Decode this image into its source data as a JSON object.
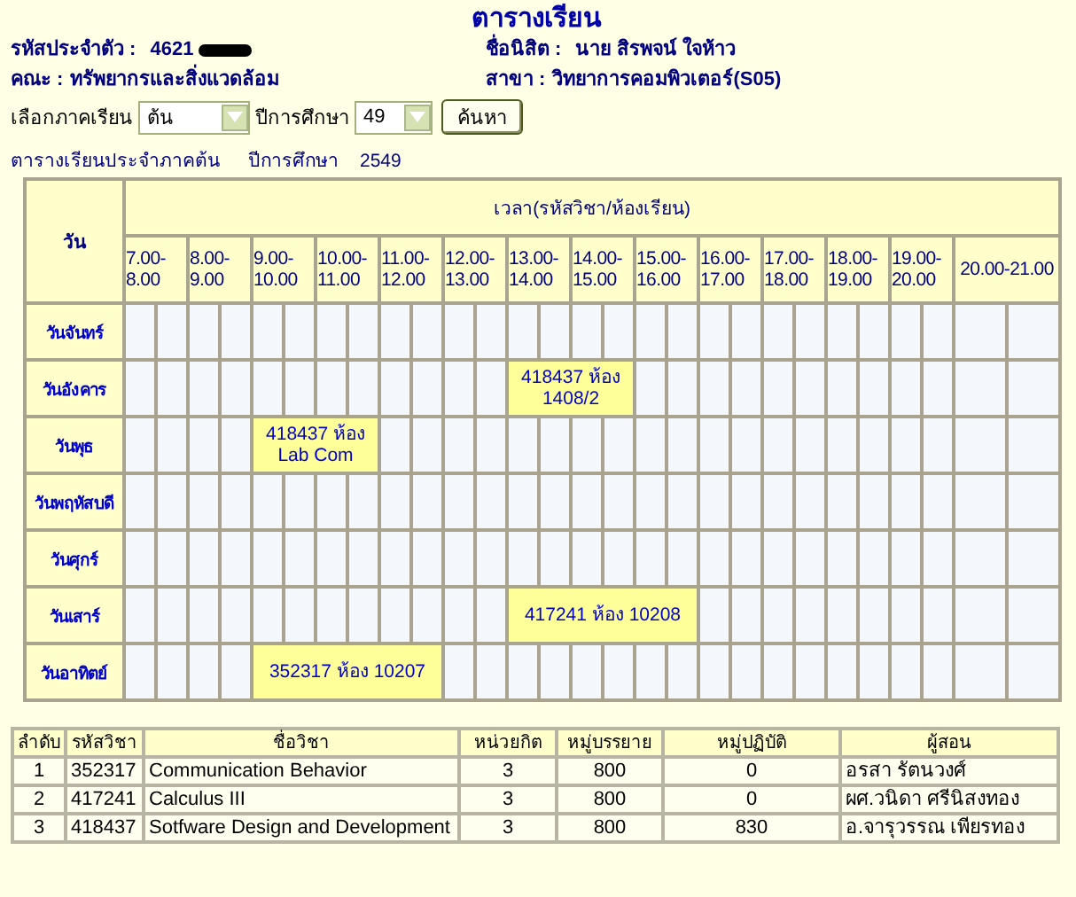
{
  "title": "ตารางเรียน",
  "student": {
    "id_label": "รหัสประจำตัว :",
    "id_value": "4621",
    "name_label": "ชื่อนิสิต :",
    "name_value": "นาย สิรพจน์ ใจห้าว",
    "faculty_label": "คณะ :",
    "faculty_value": "ทรัพยากรและสิ่งแวดล้อม",
    "major_label": "สาขา :",
    "major_value": "วิทยาการคอมพิวเตอร์(S05)"
  },
  "filters": {
    "semester_label": "เลือกภาคเรียน",
    "semester_value": "ต้น",
    "year_label": "ปีการศึกษา",
    "year_value": "49",
    "search_button": "ค้นหา"
  },
  "caption": {
    "semester_text": "ตารางเรียนประจำภาคต้น",
    "year_label": "ปีการศึกษา",
    "year_value": "2549"
  },
  "schedule": {
    "day_header": "วัน",
    "time_header": "เวลา(รหัสวิชา/ห้องเรียน)",
    "slots": [
      "7.00-8.00",
      "8.00-9.00",
      "9.00-10.00",
      "10.00-11.00",
      "11.00-12.00",
      "12.00-13.00",
      "13.00-14.00",
      "14.00-15.00",
      "15.00-16.00",
      "16.00-17.00",
      "17.00-18.00",
      "18.00-19.00",
      "19.00-20.00",
      "20.00-21.00"
    ],
    "days": [
      {
        "label": "วันจันทร์"
      },
      {
        "label": "วันอังคาร",
        "cells": [
          {
            "kind": "free"
          },
          {
            "kind": "free"
          },
          {
            "kind": "free"
          },
          {
            "kind": "free"
          },
          {
            "kind": "free"
          },
          {
            "kind": "free"
          },
          {
            "kind": "free"
          },
          {
            "kind": "free"
          },
          {
            "kind": "free"
          },
          {
            "kind": "free"
          },
          {
            "kind": "free"
          },
          {
            "kind": "free"
          },
          {
            "kind": "class",
            "text": "418437 ห้อง 1408/2"
          },
          {
            "kind": "cont"
          },
          {
            "kind": "cont"
          },
          {
            "kind": "cont"
          },
          {
            "kind": "free"
          },
          {
            "kind": "free"
          },
          {
            "kind": "free"
          },
          {
            "kind": "free"
          },
          {
            "kind": "free"
          },
          {
            "kind": "free"
          },
          {
            "kind": "free"
          },
          {
            "kind": "free"
          },
          {
            "kind": "free"
          },
          {
            "kind": "free"
          },
          {
            "kind": "free"
          },
          {
            "kind": "free"
          }
        ]
      },
      {
        "label": "วันพุธ",
        "cells": [
          {
            "kind": "free"
          },
          {
            "kind": "free"
          },
          {
            "kind": "free"
          },
          {
            "kind": "free"
          },
          {
            "kind": "class",
            "text": "418437 ห้อง Lab Com"
          },
          {
            "kind": "cont"
          },
          {
            "kind": "cont"
          },
          {
            "kind": "cont"
          },
          {
            "kind": "free"
          },
          {
            "kind": "free"
          },
          {
            "kind": "free"
          },
          {
            "kind": "free"
          },
          {
            "kind": "free"
          },
          {
            "kind": "free"
          },
          {
            "kind": "free"
          },
          {
            "kind": "free"
          },
          {
            "kind": "free"
          },
          {
            "kind": "free"
          },
          {
            "kind": "free"
          },
          {
            "kind": "free"
          },
          {
            "kind": "free"
          },
          {
            "kind": "free"
          },
          {
            "kind": "free"
          },
          {
            "kind": "free"
          },
          {
            "kind": "free"
          },
          {
            "kind": "free"
          },
          {
            "kind": "free"
          },
          {
            "kind": "free"
          }
        ]
      },
      {
        "label": "วันพฤหัสบดี"
      },
      {
        "label": "วันศุกร์"
      },
      {
        "label": "วันเสาร์",
        "cells": [
          {
            "kind": "free"
          },
          {
            "kind": "free"
          },
          {
            "kind": "free"
          },
          {
            "kind": "free"
          },
          {
            "kind": "free"
          },
          {
            "kind": "free"
          },
          {
            "kind": "free"
          },
          {
            "kind": "free"
          },
          {
            "kind": "free"
          },
          {
            "kind": "free"
          },
          {
            "kind": "free"
          },
          {
            "kind": "free"
          },
          {
            "kind": "class",
            "text": "417241 ห้อง 10208"
          },
          {
            "kind": "cont"
          },
          {
            "kind": "cont"
          },
          {
            "kind": "cont"
          },
          {
            "kind": "cont"
          },
          {
            "kind": "cont"
          },
          {
            "kind": "free"
          },
          {
            "kind": "free"
          },
          {
            "kind": "free"
          },
          {
            "kind": "free"
          },
          {
            "kind": "free"
          },
          {
            "kind": "free"
          },
          {
            "kind": "free"
          },
          {
            "kind": "free"
          },
          {
            "kind": "free"
          },
          {
            "kind": "free"
          }
        ]
      },
      {
        "label": "วันอาทิตย์",
        "cells": [
          {
            "kind": "free"
          },
          {
            "kind": "free"
          },
          {
            "kind": "free"
          },
          {
            "kind": "free"
          },
          {
            "kind": "class",
            "text": "352317 ห้อง 10207"
          },
          {
            "kind": "cont"
          },
          {
            "kind": "cont"
          },
          {
            "kind": "cont"
          },
          {
            "kind": "cont"
          },
          {
            "kind": "cont"
          },
          {
            "kind": "free"
          },
          {
            "kind": "free"
          },
          {
            "kind": "free"
          },
          {
            "kind": "free"
          },
          {
            "kind": "free"
          },
          {
            "kind": "free"
          },
          {
            "kind": "free"
          },
          {
            "kind": "free"
          },
          {
            "kind": "free"
          },
          {
            "kind": "free"
          },
          {
            "kind": "free"
          },
          {
            "kind": "free"
          },
          {
            "kind": "free"
          },
          {
            "kind": "free"
          },
          {
            "kind": "free"
          },
          {
            "kind": "free"
          },
          {
            "kind": "free"
          },
          {
            "kind": "free"
          }
        ]
      }
    ]
  },
  "courses": {
    "columns": [
      "ลำดับ",
      "รหัสวิชา",
      "ชื่อวิชา",
      "หน่วยกิต",
      "หมู่บรรยาย",
      "หมู่ปฏิบัติ",
      "ผู้สอน"
    ],
    "rows": [
      [
        "1",
        "352317",
        "Communication Behavior",
        "3",
        "800",
        "0",
        "อรสา รัตนวงศ์"
      ],
      [
        "2",
        "417241",
        "Calculus III",
        "3",
        "800",
        "0",
        "ผศ.วนิดา ศรีนิสงทอง"
      ],
      [
        "3",
        "418437",
        "Sotfware Design and Development",
        "3",
        "800",
        "830",
        "อ.จารุวรรณ เพียรทอง"
      ]
    ]
  }
}
